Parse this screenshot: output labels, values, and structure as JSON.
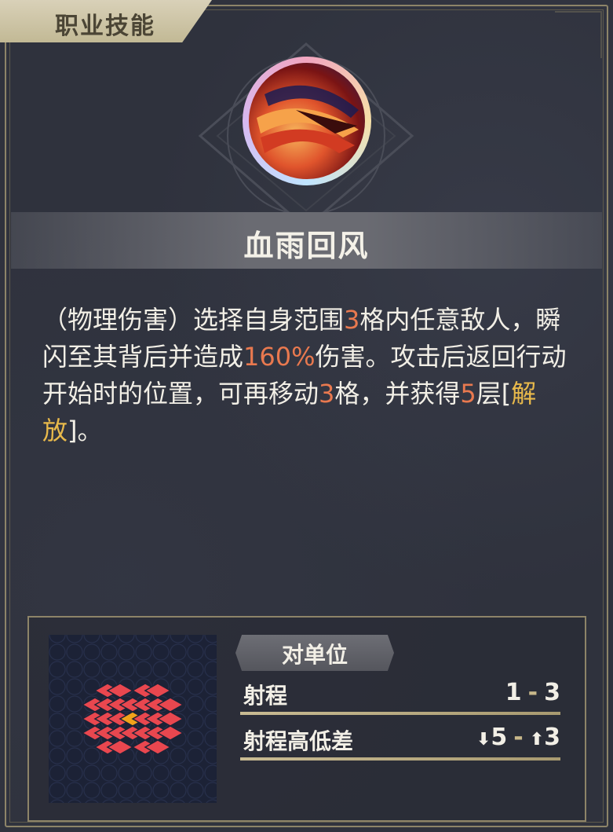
{
  "header": {
    "title": "职业技能"
  },
  "skill": {
    "name": "血雨回风",
    "description": {
      "s1": "（物理伤害）选择自身范围",
      "range_cells": "3",
      "s2": "格内任意敌人，瞬闪至其背后并造成",
      "damage": "160%",
      "s3": "伤害。攻击后返回行动开始时的位置，可再移动",
      "move_cells": "3",
      "s4": "格，并获得",
      "stacks": "5",
      "s5": "层[",
      "status": "解放",
      "s6": "]。"
    }
  },
  "info": {
    "target_tag": "对单位",
    "range_label": "射程",
    "range_min": "1",
    "range_max": "3",
    "range_sep": "-",
    "height_label": "射程高低差",
    "height_down": "5",
    "height_up": "3",
    "down_arrow": "⬇",
    "up_arrow": "⬆"
  },
  "colors": {
    "highlight": "#e9794f",
    "keyword": "#e8b94b",
    "grid_cell": "#e9474f",
    "grid_center": "#f2a21a"
  },
  "grid": {
    "rows": [
      [
        0,
        1,
        1,
        0,
        1,
        1,
        0
      ],
      [
        1,
        1,
        1,
        1,
        1,
        1,
        1
      ],
      [
        1,
        1,
        1,
        2,
        1,
        1,
        1
      ],
      [
        1,
        1,
        1,
        1,
        1,
        1,
        1
      ],
      [
        0,
        1,
        1,
        0,
        1,
        1,
        0
      ]
    ]
  }
}
